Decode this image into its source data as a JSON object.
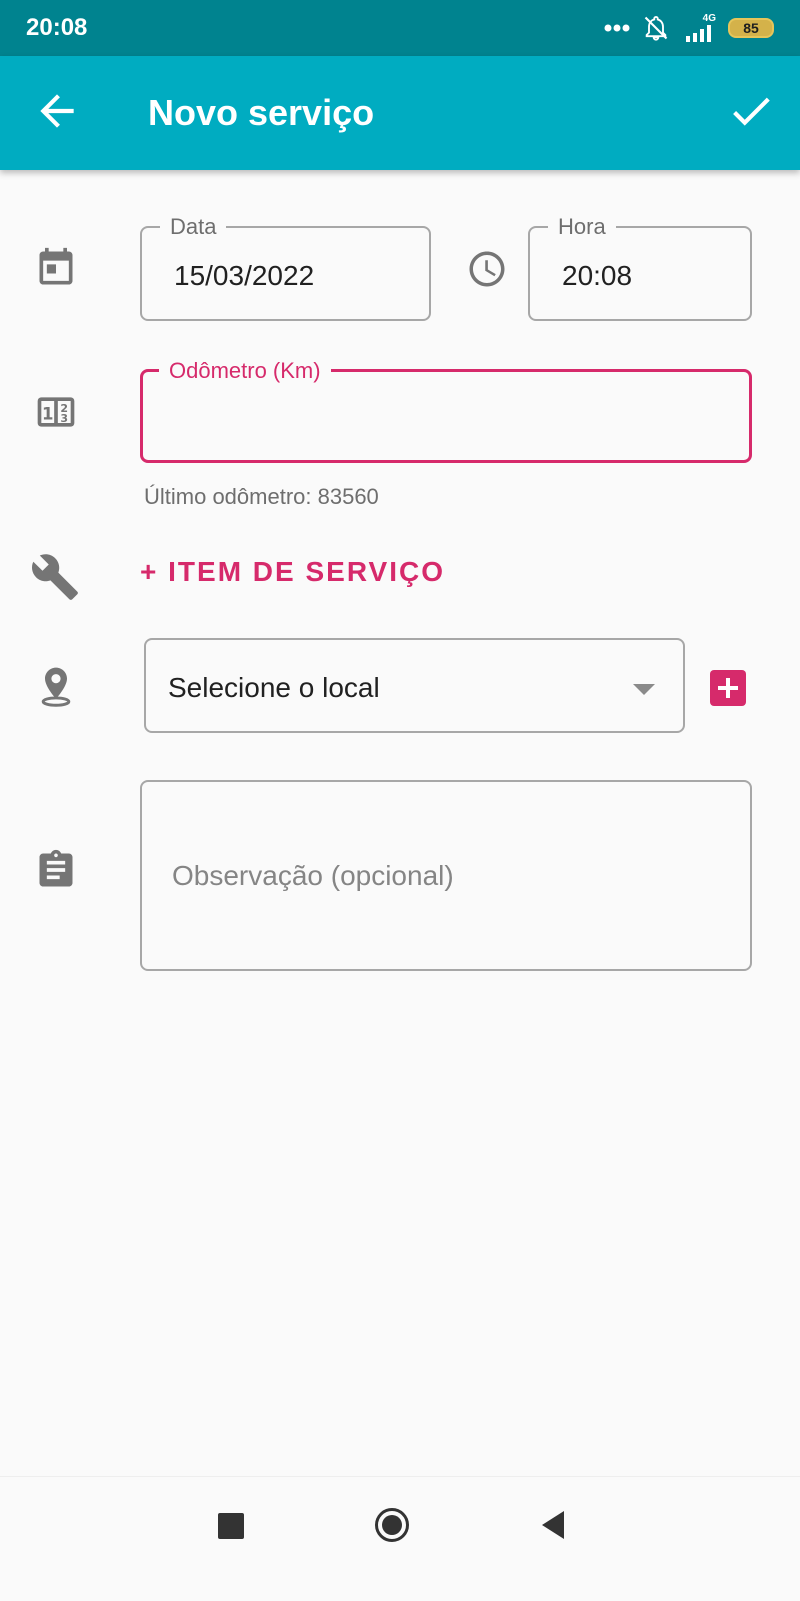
{
  "status_bar": {
    "time": "20:08",
    "network": "4G",
    "battery": "85",
    "icons": [
      "more-dots-icon",
      "notifications-off-icon",
      "signal-icon",
      "battery-icon"
    ]
  },
  "app_bar": {
    "title": "Novo serviço",
    "back_icon": "arrow-back-icon",
    "confirm_icon": "check-icon",
    "background": "#00acc1"
  },
  "form": {
    "date": {
      "label": "Data",
      "value": "15/03/2022"
    },
    "time": {
      "label": "Hora",
      "value": "20:08"
    },
    "odometer": {
      "label": "Odômetro (Km)",
      "value": "",
      "helper": "Último odômetro: 83560"
    },
    "service_item": {
      "label": "+ ITEM DE SERVIÇO"
    },
    "location": {
      "value": "Selecione o local"
    },
    "observation": {
      "placeholder": "Observação (opcional)"
    }
  },
  "colors": {
    "accent": "#d62a6b",
    "primary": "#00acc1",
    "status_bar": "#00838f"
  },
  "nav_bar": {
    "icons": [
      "recents-square-icon",
      "home-circle-icon",
      "back-triangle-icon"
    ]
  }
}
